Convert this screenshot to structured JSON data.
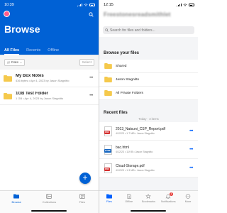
{
  "box": {
    "status": {
      "time": "10:39"
    },
    "title": "Browse",
    "tabs": [
      {
        "label": "All Files"
      },
      {
        "label": "Recents"
      },
      {
        "label": "Offline"
      }
    ],
    "toolbar": {
      "sort_label": "Date",
      "select_label": "Select"
    },
    "rows": [
      {
        "name": "My Box Notes",
        "meta": "436 bytes • Apr 4, 2023 by Jason Stagnitto"
      },
      {
        "name": "1GB Test Folder",
        "meta": "1 GB • Apr 4, 2023 by Jason Stagnitto"
      }
    ],
    "fab_label": "+",
    "nav": [
      {
        "label": "Browse",
        "icon": "folder-icon"
      },
      {
        "label": "Collections",
        "icon": "collections-icon"
      },
      {
        "label": "Files",
        "icon": "files-icon"
      }
    ],
    "colors": {
      "brand": "#0061d5",
      "folder": "#f5c94c"
    }
  },
  "dropbox": {
    "status": {
      "time": "12:15"
    },
    "account_name": "Freestonesreadsmithlet",
    "search_placeholder": "Search for files and folders...",
    "browse_title": "Browse your files",
    "folders": [
      {
        "name": "Shared"
      },
      {
        "name": "Jason Stagnitto"
      },
      {
        "name": "All Private Folders"
      }
    ],
    "recent_title": "Recent files",
    "today_label": "Today · 3 items",
    "files": [
      {
        "name": "2013_Natsuni_CSP_Report.pdf",
        "meta": "4/12/23 • 1.7 MB • Jason Stagnitto",
        "type": "PDF",
        "tag_color": "#d32f2f"
      },
      {
        "name": "bac.html",
        "meta": "4/12/23 • 119 B • Jason Stagnitto",
        "type": "HTML",
        "tag_color": "#1565c0"
      },
      {
        "name": "Cloud-Storage.pdf",
        "meta": "4/12/23 • 1.3 MB • Jason Stagnitto",
        "type": "PDF",
        "tag_color": "#d32f2f"
      }
    ],
    "nav": [
      {
        "label": "Files",
        "icon": "files-icon"
      },
      {
        "label": "Offline",
        "icon": "offline-icon"
      },
      {
        "label": "Bookmarks",
        "icon": "star-icon"
      },
      {
        "label": "Notifications",
        "icon": "bell-icon",
        "badge": "1"
      },
      {
        "label": "More",
        "icon": "more-icon"
      }
    ],
    "colors": {
      "brand": "#0061fe",
      "folder": "#f5c94c"
    }
  }
}
